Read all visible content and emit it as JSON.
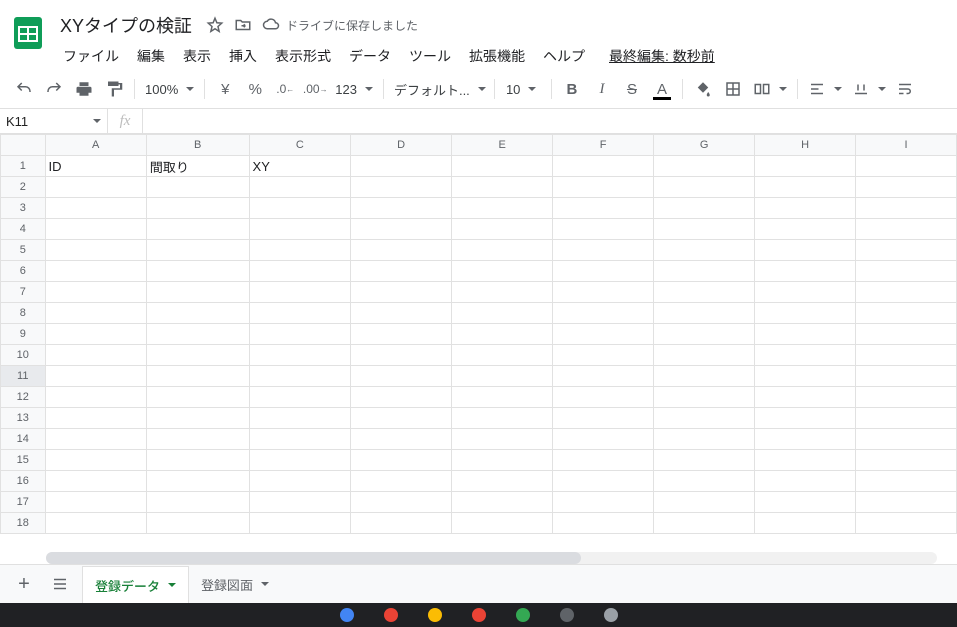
{
  "header": {
    "title": "XYタイプの検証",
    "saved_message": "ドライブに保存しました",
    "last_edit": "最終編集: 数秒前"
  },
  "menu": [
    "ファイル",
    "編集",
    "表示",
    "挿入",
    "表示形式",
    "データ",
    "ツール",
    "拡張機能",
    "ヘルプ"
  ],
  "toolbar": {
    "zoom": "100%",
    "currency_symbol": "¥",
    "percent": "%",
    "format_menu": "123",
    "font": "デフォルト...",
    "font_size": "10"
  },
  "namebox": {
    "ref": "K11",
    "fx_label": "fx",
    "formula": ""
  },
  "grid": {
    "columns": [
      "A",
      "B",
      "C",
      "D",
      "E",
      "F",
      "G",
      "H",
      "I"
    ],
    "rows": [
      "1",
      "2",
      "3",
      "4",
      "5",
      "6",
      "7",
      "8",
      "9",
      "10",
      "11",
      "12",
      "13",
      "14",
      "15",
      "16",
      "17",
      "18"
    ],
    "cells": {
      "A1": "ID",
      "B1": "間取り",
      "C1": "XY"
    },
    "selected_row": "11"
  },
  "sheet_tabs": [
    {
      "name": "登録データ",
      "active": true
    },
    {
      "name": "登録図面",
      "active": false
    }
  ],
  "icons": {
    "star": "star-icon",
    "move": "move-to-icon",
    "cloud": "cloud-saved-icon",
    "undo": "undo-icon",
    "redo": "redo-icon",
    "print": "print-icon",
    "paint": "paint-format-icon",
    "dec_dec": "decrease-decimal-icon",
    "inc_dec": "increase-decimal-icon",
    "bold": "bold-icon",
    "italic": "italic-icon",
    "strike": "strikethrough-icon",
    "textcolor": "text-color-icon",
    "fill": "fill-color-icon",
    "borders": "borders-icon",
    "merge": "merge-icon",
    "halign": "horizontal-align-icon",
    "valign": "vertical-align-icon",
    "wrap": "text-wrap-icon",
    "add_sheet": "add-sheet-icon",
    "all_sheets": "all-sheets-icon"
  },
  "taskbar_colors": [
    "#4285f4",
    "#ea4335",
    "#fbbc04",
    "#ea4335",
    "#34a853",
    "#5f6368",
    "#9aa0a6"
  ]
}
